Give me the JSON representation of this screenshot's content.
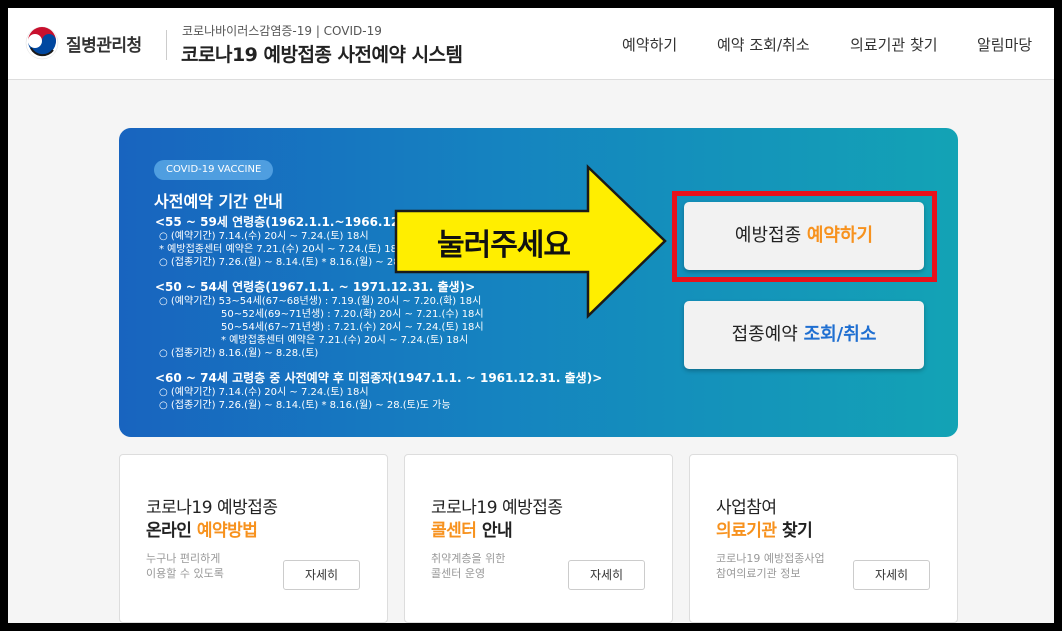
{
  "header": {
    "logo_text": "질병관리청",
    "sys_sub": "코로나바이러스감염증-19 | COVID-19",
    "sys_title": "코로나19 예방접종 사전예약 시스템",
    "nav": [
      "예약하기",
      "예약 조회/취소",
      "의료기관 찾기",
      "알림마당"
    ]
  },
  "banner": {
    "pill": "COVID-19 VACCINE",
    "title": "사전예약 기간 안내",
    "groups": [
      {
        "heading": "<55 ~ 59세 연령층(1962.1.1.~1966.12.31. 출생)>",
        "lines": [
          "○ (예약기간) 7.14.(수) 20시 ~ 7.24.(토) 18시",
          "* 예방접종센터 예약은 7.21.(수) 20시 ~ 7.24.(토) 18시",
          "○ (접종기간) 7.26.(월) ~ 8.14.(토)     * 8.16.(월) ~ 28.(토)도 가능"
        ]
      },
      {
        "heading": "<50 ~ 54세 연령층(1967.1.1. ~ 1971.12.31. 출생)>",
        "lines": [
          "○ (예약기간) 53~54세(67~68년생) : 7.19.(월) 20시 ~ 7.20.(화) 18시",
          "50~52세(69~71년생) : 7.20.(화) 20시 ~ 7.21.(수) 18시",
          "50~54세(67~71년생) : 7.21.(수) 20시 ~ 7.24.(토) 18시",
          "* 예방접종센터 예약은 7.21.(수) 20시 ~ 7.24.(토) 18시",
          "○ (접종기간) 8.16.(월) ~ 8.28.(토)"
        ]
      },
      {
        "heading": "<60 ~ 74세 고령층 중 사전예약 후 미접종자(1947.1.1. ~ 1961.12.31. 출생)>",
        "lines": [
          "○ (예약기간) 7.14.(수) 20시 ~ 7.24.(토) 18시",
          "○ (접종기간) 7.26.(월) ~ 8.14.(토)     * 8.16.(월) ~ 28.(토)도 가능"
        ]
      }
    ],
    "arrow_text": "눌러주세요",
    "reserve_btn": {
      "pre": "예방접종 ",
      "hl": "예약하기"
    },
    "inquiry_btn": {
      "pre": "접종예약 ",
      "hl": "조회/취소"
    }
  },
  "cards": [
    {
      "t1": "코로나19 예방접종",
      "t2_pre": "온라인 ",
      "t2_hl": "예약방법",
      "t2_post": "",
      "d1": "누구나 편리하게",
      "d2": "이용할 수 있도록",
      "more": "자세히"
    },
    {
      "t1": "코로나19 예방접종",
      "t2_pre": "",
      "t2_hl": "콜센터",
      "t2_post": " 안내",
      "d1": "취약계층을 위한",
      "d2": "콜센터 운영",
      "more": "자세히"
    },
    {
      "t1": "사업참여",
      "t2_pre": "",
      "t2_hl": "의료기관",
      "t2_post": " 찾기",
      "d1": "코로나19 예방접종사업",
      "d2": "참여의료기관 정보",
      "more": "자세히"
    }
  ],
  "colors": {
    "accent_orange": "#f7921e",
    "accent_blue": "#1f6fd1",
    "highlight_red": "#e8111a",
    "arrow_yellow": "#ffee00"
  }
}
